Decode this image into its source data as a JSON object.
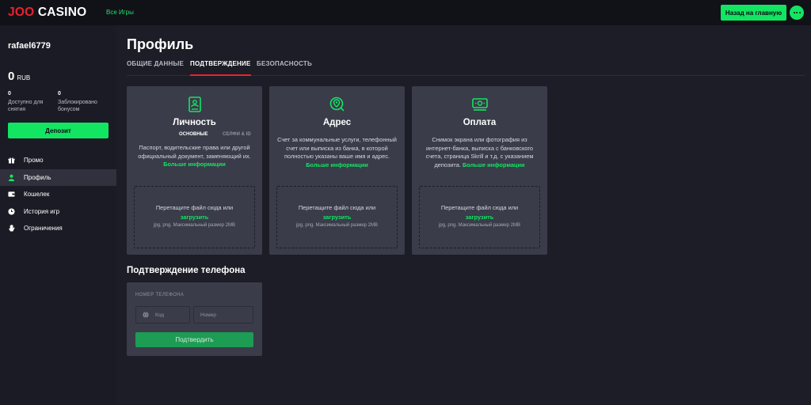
{
  "header": {
    "logo_left": "JOO",
    "logo_right": "CASINO",
    "nav_all_games": "Все Игры",
    "home_button": "Назад на главную",
    "more_icon": "dots-icon"
  },
  "sidebar": {
    "username": "rafael6779",
    "balance_value": "0",
    "balance_currency": "RUB",
    "stats": [
      {
        "value": "0",
        "label": "Доступно для снятия"
      },
      {
        "value": "0",
        "label": "Заблокировано бонусом"
      }
    ],
    "deposit_button": "Депозит",
    "menu": [
      {
        "label": "Промо",
        "icon": "gift-icon",
        "active": false
      },
      {
        "label": "Профиль",
        "icon": "user-icon",
        "active": true
      },
      {
        "label": "Кошелек",
        "icon": "wallet-icon",
        "active": false
      },
      {
        "label": "История игр",
        "icon": "clock-icon",
        "active": false
      },
      {
        "label": "Ограничения",
        "icon": "hand-icon",
        "active": false
      }
    ]
  },
  "main": {
    "title": "Профиль",
    "tabs": [
      {
        "label": "ОБЩИЕ ДАННЫЕ",
        "active": false
      },
      {
        "label": "ПОДТВЕРЖДЕНИЕ",
        "active": true
      },
      {
        "label": "БЕЗОПАСНОСТЬ",
        "active": false
      }
    ],
    "cards": [
      {
        "title": "Личность",
        "icon": "id-document-icon",
        "subtabs": [
          "ОСНОВНЫЕ",
          "СЕЛФИ & ID"
        ],
        "description": "Паспорт, водительские права или другой официальный документ, заменяющий их.",
        "more_link": "Больше информации",
        "drop_text": "Перетащите файл сюда или",
        "drop_link": "загрузить",
        "drop_hint": "jpg, png. Максимальный размер 2MB"
      },
      {
        "title": "Адрес",
        "icon": "location-icon",
        "description": "Счет за коммунальные услуги, телефонный счет или выписка из банка, в которой полностью указаны ваше имя и адрес.",
        "more_link": "Больше информации",
        "drop_text": "Перетащите файл сюда или",
        "drop_link": "загрузить",
        "drop_hint": "jpg, png. Максимальный размер 2MB"
      },
      {
        "title": "Оплата",
        "icon": "payment-icon",
        "description": "Снимок экрана или фотография из интернет-банка, выписка с банковского счета, страница Skrill и т.д. с указанием депозита.",
        "more_link": "Больше информации",
        "drop_text": "Перетащите файл сюда или",
        "drop_link": "загрузить",
        "drop_hint": "jpg, png. Максимальный размер 2MB"
      }
    ],
    "phone": {
      "title": "Подтверждение телефона",
      "label": "НОМЕР ТЕЛЕФОНА",
      "code_placeholder": "Код",
      "number_placeholder": "Номер",
      "confirm_button": "Подтвердить"
    }
  },
  "colors": {
    "accent_green": "#12e562",
    "brand_red": "#e8232d",
    "background": "#1c1d26",
    "card": "#3a3c4a"
  }
}
